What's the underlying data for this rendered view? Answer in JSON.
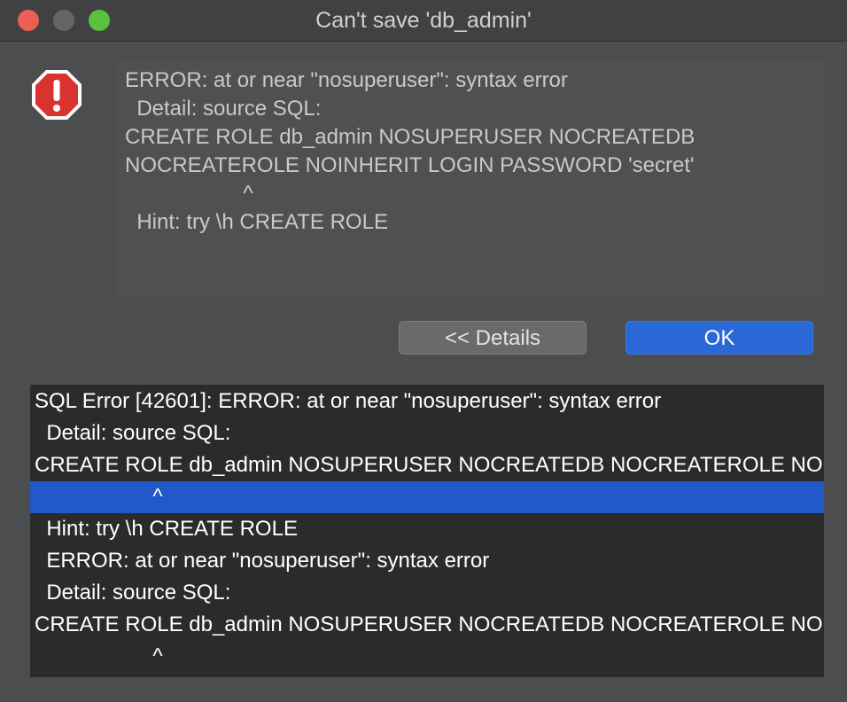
{
  "window": {
    "title": "Can't save 'db_admin'"
  },
  "icons": {
    "alert": "error-stop-sign-icon",
    "alert_color": "#d8332f"
  },
  "message": {
    "lines": [
      "ERROR: at or near \"nosuperuser\": syntax error",
      "  Detail: source SQL:",
      "CREATE ROLE db_admin NOSUPERUSER NOCREATEDB",
      "NOCREATEROLE NOINHERIT LOGIN PASSWORD 'secret'",
      "                    ^",
      "  Hint: try \\h CREATE ROLE"
    ]
  },
  "buttons": {
    "details_label": "<< Details",
    "ok_label": "OK"
  },
  "details": {
    "selected_index": 3,
    "lines": [
      "SQL Error [42601]: ERROR: at or near \"nosuperuser\": syntax error",
      "  Detail: source SQL:",
      "CREATE ROLE db_admin NOSUPERUSER NOCREATEDB NOCREATEROLE NOINHERIT LOGIN PASSWORD 'secret'",
      "                    ^",
      "  Hint: try \\h CREATE ROLE",
      "  ERROR: at or near \"nosuperuser\": syntax error",
      "  Detail: source SQL:",
      "CREATE ROLE db_admin NOSUPERUSER NOCREATEDB NOCREATEROLE NOINHERIT LOGIN PASSWORD 'secret'",
      "                    ^"
    ]
  },
  "colors": {
    "accent": "#2a67d7",
    "selection": "#2258c9"
  }
}
